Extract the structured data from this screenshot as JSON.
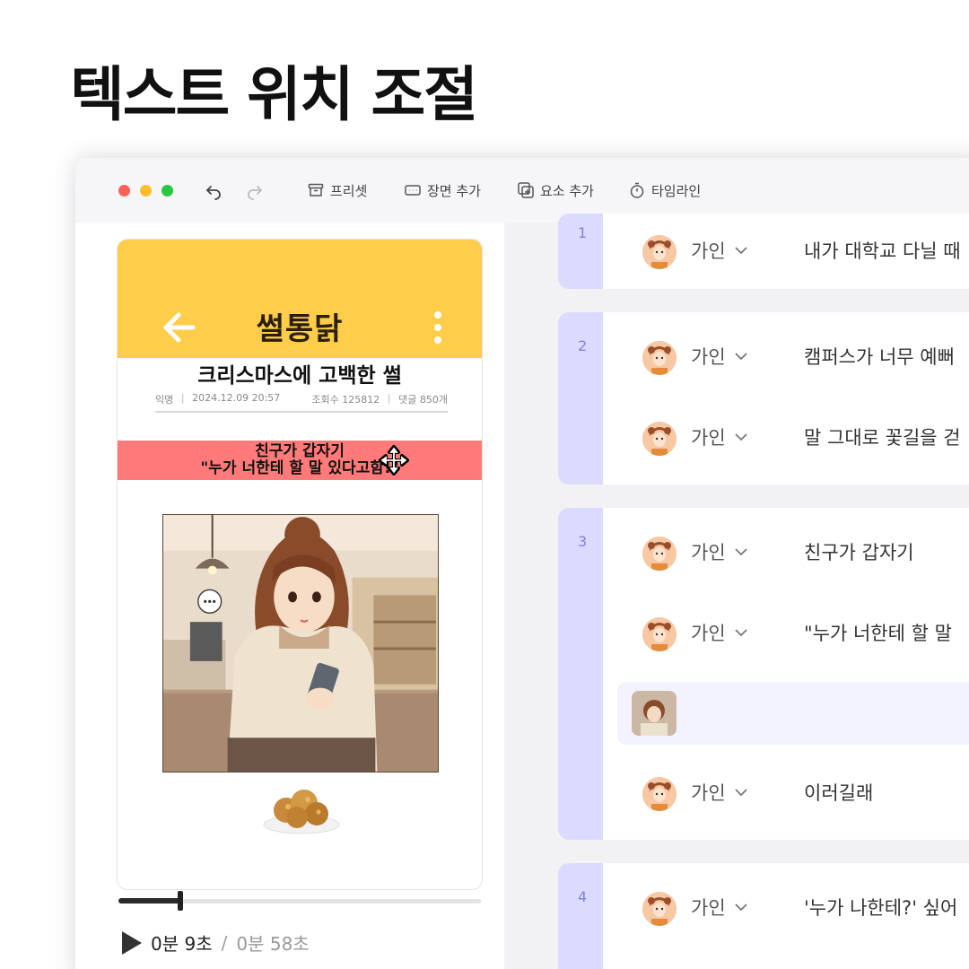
{
  "headline": "텍스트 위치 조절",
  "toolbar": {
    "items": [
      {
        "label": "프리셋",
        "icon": "archive-icon"
      },
      {
        "label": "장면 추가",
        "icon": "scene-add-icon"
      },
      {
        "label": "요소 추가",
        "icon": "element-add-icon"
      },
      {
        "label": "타임라인",
        "icon": "stopwatch-icon"
      }
    ]
  },
  "preview": {
    "app_title": "썰통닭",
    "post_title": "크리스마스에 고백한 썰",
    "meta": {
      "author": "익명",
      "date": "2024.12.09 20:57",
      "views": "조회수 125812",
      "comments": "댓글 850개"
    },
    "caption_line1": "친구가 갑자기",
    "caption_line2": "\"누가 너한테 할 말 있다고함!\"",
    "colors": {
      "header": "#ffcd4a",
      "caption": "#ff7a78"
    }
  },
  "player": {
    "current_time": "0분 9초",
    "separator": "/",
    "total_time": "0분 58초",
    "progress": 0.17
  },
  "scenes": [
    {
      "number": "1",
      "lines": [
        {
          "speaker": "가인",
          "text": "내가 대학교 다닐 때"
        }
      ]
    },
    {
      "number": "2",
      "lines": [
        {
          "speaker": "가인",
          "text": "캠퍼스가 너무 예뻐"
        },
        {
          "speaker": "가인",
          "text": "말 그대로 꽃길을 걷"
        }
      ]
    },
    {
      "number": "3",
      "lines": [
        {
          "speaker": "가인",
          "text": "친구가 갑자기"
        },
        {
          "speaker": "가인",
          "text": "\"누가 너한테 할 말"
        },
        {
          "speaker": "",
          "text": ""
        },
        {
          "speaker": "가인",
          "text": "이러길래"
        }
      ]
    },
    {
      "number": "4",
      "lines": [
        {
          "speaker": "가인",
          "text": "'누가 나한테?' 싶어"
        }
      ]
    }
  ]
}
